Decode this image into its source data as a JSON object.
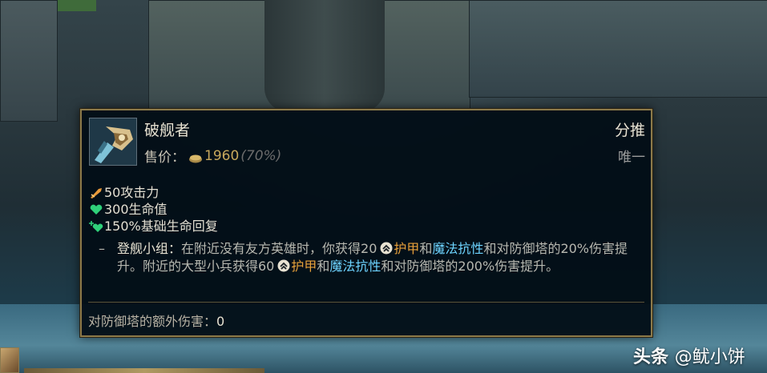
{
  "tooltip": {
    "item_name": "破舰者",
    "category": "分推",
    "price_label": "售价：",
    "price": "1960",
    "price_pct": "(70%)",
    "unique": "唯一",
    "stats": [
      {
        "icon": "attack-damage-icon",
        "text": "50攻击力"
      },
      {
        "icon": "health-icon",
        "text": "300生命值"
      },
      {
        "icon": "health-regen-icon",
        "text": "150%基础生命回复"
      }
    ],
    "passive": {
      "dash": "–",
      "name": "登舰小组：",
      "text_1": "在附近没有友方英雄时，你获得20",
      "armor_1": "护甲",
      "and_1": "和",
      "mr_1": "魔法抗性",
      "text_2": "和对防御塔的20%伤害提升。附近的大型小兵获得60",
      "armor_2": "护甲",
      "and_2": "和",
      "mr_2": "魔法抗性",
      "text_3": "和对防御塔的200%伤害提升。"
    },
    "footer_label": "对防御塔的额外伤害：",
    "footer_value": "0"
  },
  "watermark": {
    "brand": "头条",
    "handle": "@鱿小饼"
  },
  "colors": {
    "border_gold": "#8c7a4a",
    "price_gold": "#c8a85c",
    "armor": "#e8a03a",
    "magic_resist": "#6ed4ff"
  }
}
